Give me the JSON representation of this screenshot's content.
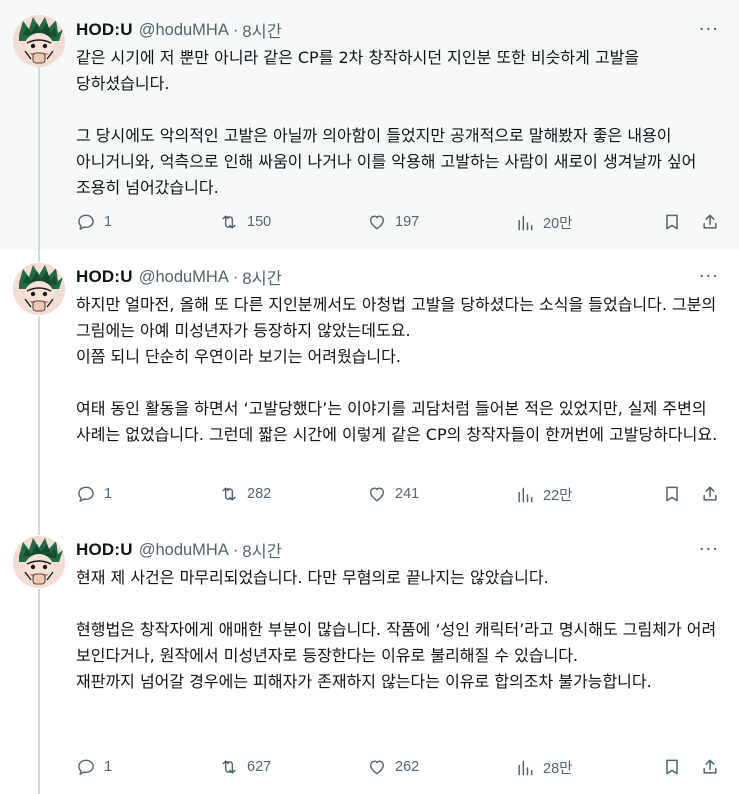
{
  "tweets": [
    {
      "name": "HOD:U",
      "handle": "@hoduMHA",
      "separator": "·",
      "time": "8시간",
      "more": "···",
      "paragraphs": [
        "같은 시기에 저 뿐만 아니라 같은 CP를 2차 창작하시던 지인분 또한 비슷하게 고발을 당하셨습니다.",
        "",
        "그 당시에도 악의적인 고발은 아닐까 의아함이 들었지만 공개적으로 말해봤자 좋은 내용이 아니거니와, 억측으로 인해 싸움이 나거나 이를 악용해 고발하는 사람이 새로이 생겨날까 싶어 조용히 넘어갔습니다."
      ],
      "replies": "1",
      "reposts": "150",
      "likes": "197",
      "views": "20만"
    },
    {
      "name": "HOD:U",
      "handle": "@hoduMHA",
      "separator": "·",
      "time": "8시간",
      "more": "···",
      "paragraphs": [
        "하지만 얼마전, 올해 또 다른 지인분께서도 아청법 고발을 당하셨다는 소식을 들었습니다. 그분의 그림에는 아예 미성년자가 등장하지 않았는데도요.",
        "이쯤 되니 단순히 우연이라 보기는 어려웠습니다.",
        "",
        "여태 동인 활동을 하면서 ‘고발당했다’는 이야기를 괴담처럼 들어본 적은 있었지만, 실제 주변의 사례는 없었습니다. 그런데 짧은 시간에 이렇게 같은 CP의 창작자들이 한꺼번에 고발당하다니요."
      ],
      "replies": "1",
      "reposts": "282",
      "likes": "241",
      "views": "22만"
    },
    {
      "name": "HOD:U",
      "handle": "@hoduMHA",
      "separator": "·",
      "time": "8시간",
      "more": "···",
      "paragraphs": [
        "현재 제 사건은 마무리되었습니다. 다만 무혐의로 끝나지는 않았습니다.",
        "",
        "현행법은 창작자에게 애매한 부분이 많습니다. 작품에 ‘성인 캐릭터’라고 명시해도 그림체가 어려 보인다거나, 원작에서 미성년자로 등장한다는 이유로 불리해질 수 있습니다.",
        "재판까지 넘어갈 경우에는 피해자가 존재하지 않는다는 이유로 합의조차 불가능합니다."
      ],
      "replies": "1",
      "reposts": "627",
      "likes": "262",
      "views": "28만"
    }
  ],
  "icons": {
    "reply": "reply-bubble-icon",
    "repost": "repost-arrows-icon",
    "like": "heart-icon",
    "views": "views-bar-chart-icon",
    "bookmark": "bookmark-icon",
    "share": "share-upload-icon",
    "more": "more-dots-icon"
  },
  "colors": {
    "text": "#0f1419",
    "secondary": "#536471",
    "highlight_bg": "#f7f9f9",
    "thread_line": "#cfd9de"
  }
}
